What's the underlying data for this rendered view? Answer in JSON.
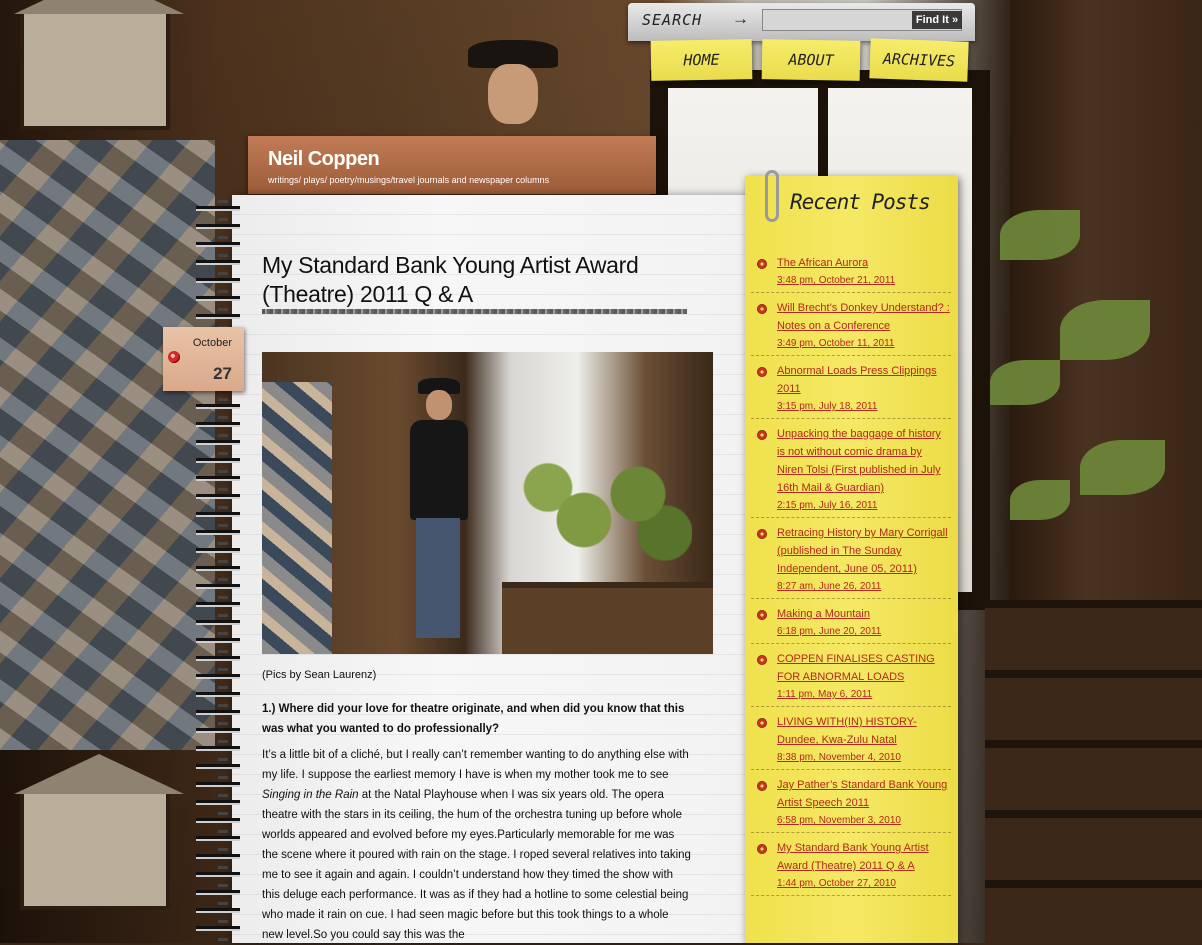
{
  "search": {
    "label": "SEARCH",
    "arrow": "→",
    "placeholder": "",
    "button_label": "Find It »"
  },
  "nav": {
    "home": "HOME",
    "about": "ABOUT",
    "archives": "ARCHIVES"
  },
  "site": {
    "title": "Neil Coppen",
    "tagline": "writings/ plays/ poetry/musings/travel journals and newspaper columns"
  },
  "post": {
    "month": "October",
    "day": "27",
    "title": "My Standard Bank Young Artist Award (Theatre) 2011 Q & A",
    "caption": "(Pics by Sean Laurenz)",
    "question": "1.) Where did your love for theatre originate, and when did you know that this was what you wanted to do professionally?",
    "answer_part1": "It’s a little bit of a cliché, but I really can’t remember wanting to do anything else with my life. I suppose the earliest memory I have is when my mother took me to see ",
    "answer_italic": "Singing in the Rain",
    "answer_part2": " at the Natal Playhouse when I was six years old. The opera theatre with the stars in its ceiling, the hum of the orchestra tuning up before whole worlds appeared and evolved before my eyes.Particularly memorable for me was the scene where it poured with rain on the stage. I roped several relatives into taking me to see it again and again. I couldn’t understand how they timed the show with this deluge each performance. It was as if they had a hotline to some celestial being who made it rain on cue. I had seen magic before but this took things to a whole new level.So you could say this was the"
  },
  "sidebar": {
    "title": "Recent Posts",
    "items": [
      {
        "title": "The African Aurora",
        "date": "3:48 pm, October 21, 2011"
      },
      {
        "title": "Will Brecht’s Donkey Understand? : Notes on a Conference",
        "date": "3:49 pm, October 11, 2011"
      },
      {
        "title": "Abnormal Loads Press Clippings 2011",
        "date": "3:15 pm, July 18, 2011"
      },
      {
        "title": "Unpacking the baggage of history is not without comic drama by Niren Tolsi (First published in July 16th Mail & Guardian)",
        "date": "2:15 pm, July 16, 2011"
      },
      {
        "title": "Retracing History by Mary Corrigall (published in The Sunday Independent, June 05, 2011)",
        "date": "8:27 am, June 26, 2011"
      },
      {
        "title": "Making a Mountain",
        "date": "6:18 pm, June 20, 2011"
      },
      {
        "title": "COPPEN FINALISES CASTING FOR ABNORMAL LOADS",
        "date": "1:11 pm, May 6, 2011"
      },
      {
        "title": "LIVING WITH(IN) HISTORY- Dundee, Kwa-Zulu Natal",
        "date": "8:38 pm, November 4, 2010"
      },
      {
        "title": "Jay Pather’s Standard Bank Young Artist Speech 2011",
        "date": "6:58 pm, November 3, 2010"
      },
      {
        "title": "My Standard Bank Young Artist Award (Theatre) 2011 Q & A",
        "date": "1:44 pm, October 27, 2010"
      }
    ]
  },
  "colors": {
    "sticky_yellow": "#f2e35a",
    "link_red": "#b22a1a",
    "header_brown": "#b06a45"
  }
}
